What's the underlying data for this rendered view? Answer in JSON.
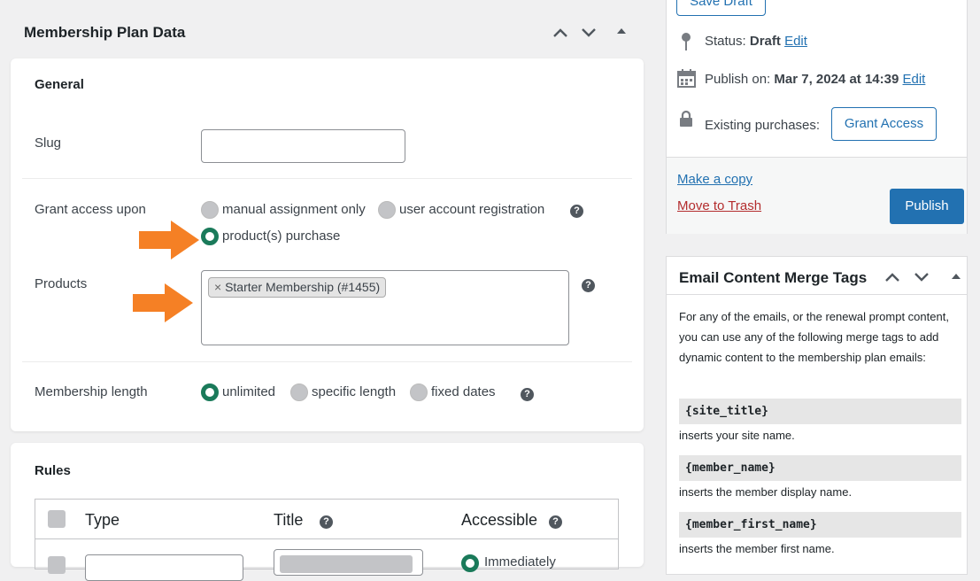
{
  "plan_box": {
    "title": "Membership Plan Data",
    "general": {
      "heading": "General",
      "slug_label": "Slug",
      "slug_value": "",
      "grant_label": "Grant access upon",
      "grant_options": [
        "manual assignment only",
        "user account registration",
        "product(s) purchase"
      ],
      "products_label": "Products",
      "product_tag": "Starter Membership (#1455)",
      "product_tag_remove": "×",
      "length_label": "Membership length",
      "length_options": [
        "unlimited",
        "specific length",
        "fixed dates"
      ],
      "help": "?"
    },
    "rules": {
      "heading": "Rules",
      "columns": [
        "Type",
        "Title",
        "Accessible"
      ],
      "row_partial": "Immediately"
    }
  },
  "publish_box": {
    "save_draft": "Save Draft",
    "status_label": "Status:",
    "status_value": "Draft",
    "publish_label": "Publish on:",
    "publish_value": "Mar 7, 2024 at 14:39",
    "edit": "Edit",
    "existing_label": "Existing purchases:",
    "grant_access": "Grant Access",
    "make_copy": "Make a copy",
    "trash": "Move to Trash",
    "publish": "Publish"
  },
  "merge_box": {
    "title": "Email Content Merge Tags",
    "intro": "For any of the emails, or the renewal prompt content, you can use any of the following merge tags to add dynamic content to the membership plan emails:",
    "tags": [
      {
        "code": "{site_title}",
        "desc": "inserts your site name."
      },
      {
        "code": "{member_name}",
        "desc": "inserts the member display name."
      },
      {
        "code": "{member_first_name}",
        "desc": "inserts the member first name."
      }
    ]
  },
  "colors": {
    "accent": "#2271b1",
    "radio_checked": "#1a7a5a",
    "arrow": "#f58025",
    "trash": "#b32d2e"
  }
}
